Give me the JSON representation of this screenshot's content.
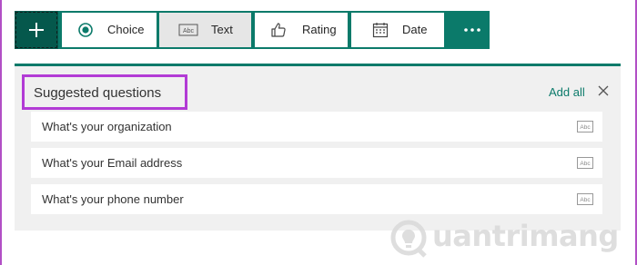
{
  "toolbar": {
    "types": [
      {
        "label": "Choice",
        "icon": "radio-button-icon"
      },
      {
        "label": "Text",
        "icon": "text-abc-icon",
        "active": true
      },
      {
        "label": "Rating",
        "icon": "thumbs-up-icon"
      },
      {
        "label": "Date",
        "icon": "calendar-icon"
      }
    ]
  },
  "suggestions": {
    "title": "Suggested questions",
    "add_all": "Add all",
    "items": [
      {
        "label": "What's your organization",
        "icon_text": "Abc"
      },
      {
        "label": "What's your Email address",
        "icon_text": "Abc"
      },
      {
        "label": "What's your phone number",
        "icon_text": "Abc"
      }
    ]
  },
  "watermark": {
    "text": "uantrimang"
  },
  "colors": {
    "accent": "#0b7a6a",
    "accent_dark": "#05584c",
    "highlight_box": "#b23bd5",
    "panel_bg": "#f0f0f0"
  }
}
